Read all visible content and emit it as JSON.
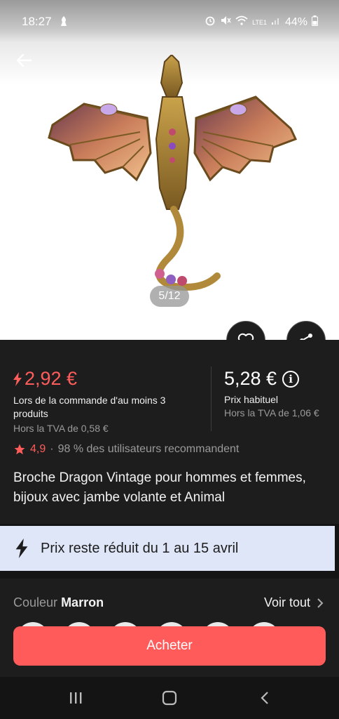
{
  "status_bar": {
    "time": "18:27",
    "battery": "44%",
    "network": "LTE1"
  },
  "gallery": {
    "counter": "5/12"
  },
  "price": {
    "promo_price": "2,92 €",
    "promo_condition": "Lors de la commande d'au moins 3 produits",
    "promo_vat": "Hors la TVA de 0,58 €",
    "usual_price": "5,28 €",
    "usual_label": "Prix habituel",
    "usual_vat": "Hors la TVA de 1,06 €"
  },
  "rating": {
    "score": "4,9",
    "separator": "·",
    "recommend": "98 % des utilisateurs recommandent"
  },
  "product": {
    "title": "Broche Dragon Vintage pour hommes et femmes, bijoux avec jambe volante et Animal"
  },
  "promo_banner": {
    "text": "Prix reste réduit du 1 au 15 avril"
  },
  "options": {
    "color_label": "Couleur",
    "color_value": "Marron",
    "see_all": "Voir tout"
  },
  "buy_button": {
    "label": "Acheter"
  },
  "colors": {
    "accent": "#ff5b5b",
    "background": "#1d1d1d",
    "promo_banner_bg": "#dfe6f8"
  }
}
